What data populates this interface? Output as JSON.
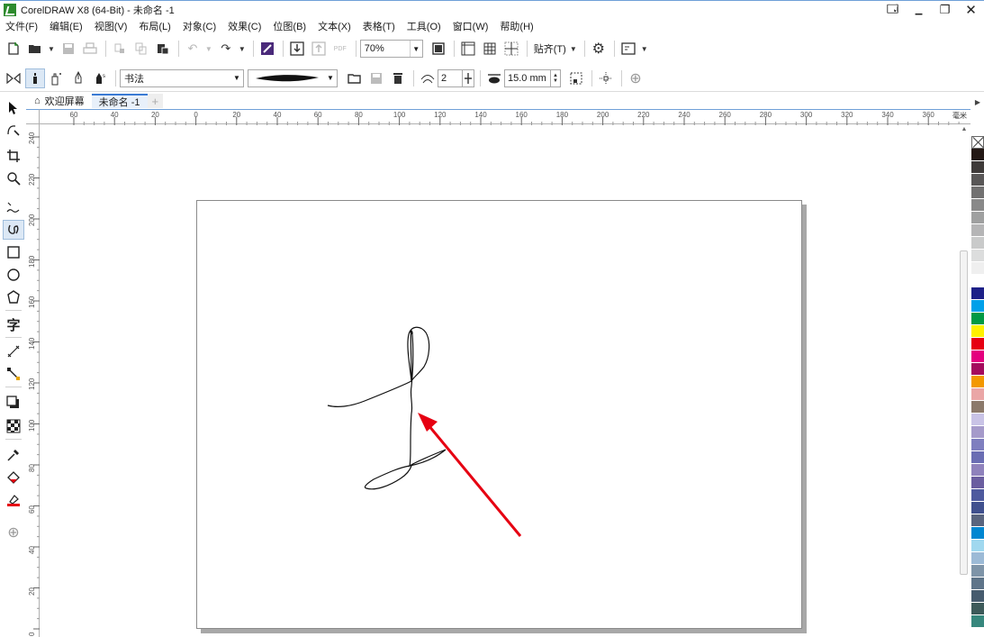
{
  "window": {
    "title": "CorelDRAW X8 (64-Bit) - 未命名 -1",
    "controls": [
      "🗔",
      "▁",
      "❐",
      "✕"
    ]
  },
  "menu": [
    "文件(F)",
    "编辑(E)",
    "视图(V)",
    "布局(L)",
    "对象(C)",
    "效果(C)",
    "位图(B)",
    "文本(X)",
    "表格(T)",
    "工具(O)",
    "窗口(W)",
    "帮助(H)"
  ],
  "standard_toolbar": {
    "zoom": "70%",
    "snap_label": "贴齐(T)"
  },
  "property_bar": {
    "mode": "书法",
    "smoothing_value": "2",
    "width_value": "15.0 mm"
  },
  "tabs": {
    "home_label": "欢迎屏幕",
    "doc_label": "未命名 -1",
    "add_label": "+"
  },
  "ruler": {
    "h_labels": [
      "60",
      "40",
      "20",
      "0",
      "20",
      "40",
      "60",
      "80",
      "100",
      "120",
      "140",
      "160",
      "180",
      "200",
      "220",
      "240",
      "260",
      "280",
      "300",
      "320",
      "340",
      "360"
    ],
    "unit": "毫米",
    "v_labels": [
      "240",
      "220",
      "200",
      "180",
      "160",
      "140",
      "120",
      "100",
      "80",
      "60",
      "40",
      "20",
      "0"
    ]
  },
  "palette": {
    "colors": [
      "#231815",
      "#3e3a39",
      "#595757",
      "#727171",
      "#898989",
      "#9fa0a0",
      "#b5b5b6",
      "#c9caca",
      "#dcdddd",
      "#efefef",
      "#ffffff",
      "#1d2088",
      "#00a0e9",
      "#009944",
      "#fff100",
      "#e60012",
      "#e4007f",
      "#a40b5d",
      "#f39800",
      "#eaa6a6",
      "#8c7a6b",
      "#c9c3e6",
      "#a59aca",
      "#7f7fbf",
      "#6a6db3",
      "#8f82bc",
      "#6b5ea0",
      "#4e5a9e",
      "#40508e",
      "#59647e",
      "#0086d1",
      "#a0d8ef",
      "#9cbad6",
      "#7e94a8",
      "#5e7489",
      "#465b6e",
      "#3d5a5a",
      "#37877d"
    ]
  },
  "annotation": {
    "arrow_color": "#e60012"
  }
}
